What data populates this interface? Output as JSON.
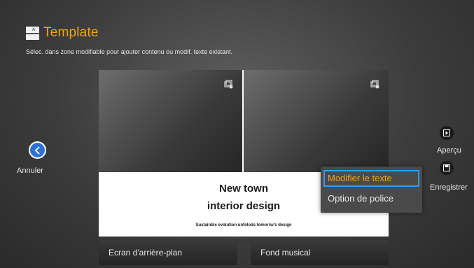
{
  "header": {
    "title": "Template",
    "subtitle": "Sélec. dans zone modifiable pour ajouter contenu ou modif. texte existant."
  },
  "nav": {
    "back_label": "Annuler"
  },
  "canvas": {
    "heading_line1": "New town",
    "heading_line2": "interior design",
    "tagline": "Sustainble evolution unfolods tomorrw's design"
  },
  "context_menu": {
    "items": [
      {
        "label": "Modifier le texte",
        "selected": true
      },
      {
        "label": "Option de police",
        "selected": false
      }
    ]
  },
  "side_actions": {
    "preview_label": "Aperçu",
    "save_label": "Enregistrer"
  },
  "bottom_bar": {
    "background_label": "Ecran d'arrière-plan",
    "music_label": "Fond musical"
  },
  "colors": {
    "accent": "#f2a31b",
    "selection_border": "#2f9bff",
    "back_button": "#2f72d6"
  }
}
